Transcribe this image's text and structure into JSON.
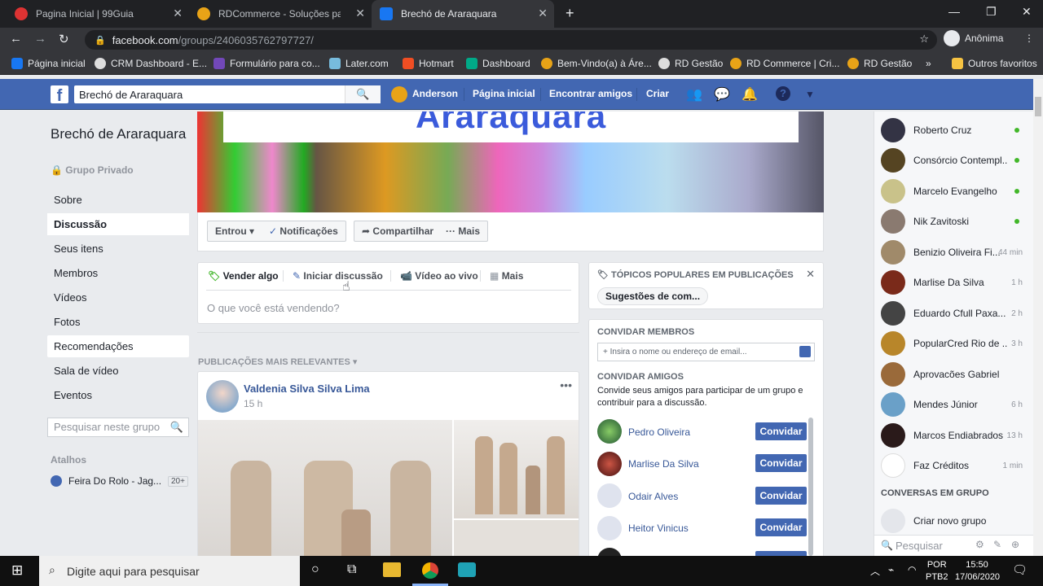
{
  "browser": {
    "tabs": [
      {
        "title": "Pagina Inicial | 99Guia",
        "active": false
      },
      {
        "title": "RDCommerce - Soluções para PME",
        "active": false
      },
      {
        "title": "Brechó de Araraquara",
        "active": true
      }
    ],
    "new_tab": "+",
    "url_domain": "facebook.com",
    "url_path": "/groups/2406035762797727/",
    "profile": "Anônima",
    "bookmarks": [
      "Página inicial",
      "CRM Dashboard - E...",
      "Formulário para co...",
      "Later.com",
      "Hotmart",
      "Dashboard",
      "Bem-Vindo(a) à Áre...",
      "RD Gestão",
      "RD Commerce | Cri...",
      "RD Gestão"
    ],
    "bookmarks_more": "»",
    "other_favorites": "Outros favoritos"
  },
  "fb": {
    "search_value": "Brechó de Araraquara",
    "user": "Anderson",
    "nav": [
      "Página inicial",
      "Encontrar amigos",
      "Criar"
    ]
  },
  "group": {
    "name": "Brechó de Araraquara",
    "privacy": "Grupo Privado",
    "cover_title": "Araraquara",
    "left_nav": [
      "Sobre",
      "Discussão",
      "Seus itens",
      "Membros",
      "Vídeos",
      "Fotos",
      "Recomendações",
      "Sala de vídeo",
      "Eventos"
    ],
    "search_placeholder": "Pesquisar neste grupo",
    "shortcuts_title": "Atalhos",
    "shortcut": "Feira Do Rolo - Jag...",
    "shortcut_count": "20+",
    "actions": {
      "joined": "Entrou",
      "notifications": "Notificações",
      "share": "Compartilhar",
      "more": "Mais"
    }
  },
  "composer": {
    "tabs": [
      "Vender algo",
      "Iniciar discussão",
      "Vídeo ao vivo",
      "Mais"
    ],
    "placeholder": "O que você está vendendo?"
  },
  "feed": {
    "sort_label": "PUBLICAÇÕES MAIS RELEVANTES",
    "post_author": "Valdenia Silva Silva Lima",
    "post_time": "15 h",
    "post_menu": "•••"
  },
  "topics": {
    "title": "TÓPICOS POPULARES EM PUBLICAÇÕES",
    "chip": "Sugestões de com..."
  },
  "invite": {
    "members_title": "CONVIDAR MEMBROS",
    "members_placeholder": "+ Insira o nome ou endereço de email...",
    "friends_title": "CONVIDAR AMIGOS",
    "friends_desc": "Convide seus amigos para participar de um grupo e contribuir para a discussão.",
    "button_label": "Convidar",
    "friends": [
      "Pedro Oliveira",
      "Marlise Da Silva",
      "Odair Alves",
      "Heitor Vinicus"
    ]
  },
  "chat": {
    "contacts": [
      {
        "name": "Roberto Cruz",
        "status": "online"
      },
      {
        "name": "Consórcio Contempl...",
        "status": "online"
      },
      {
        "name": "Marcelo Evangelho",
        "status": "online"
      },
      {
        "name": "Nik Zavitoski",
        "status": "online"
      },
      {
        "name": "Benizio Oliveira Fi...",
        "status": "44 min"
      },
      {
        "name": "Marlise Da Silva",
        "status": "1 h"
      },
      {
        "name": "Eduardo Cfull Paxa...",
        "status": "2 h"
      },
      {
        "name": "PopularCred Rio de ...",
        "status": "3 h"
      },
      {
        "name": "Aprovacões Gabriel",
        "status": ""
      },
      {
        "name": "Mendes Júnior",
        "status": "6 h"
      },
      {
        "name": "Marcos Endiabrados",
        "status": "13 h"
      },
      {
        "name": "Faz Créditos",
        "status": "1 min"
      }
    ],
    "group_conv_title": "CONVERSAS EM GRUPO",
    "new_group": "Criar novo grupo",
    "search_placeholder": "Pesquisar"
  },
  "taskbar": {
    "search": "Digite aqui para pesquisar",
    "lang1": "POR",
    "lang2": "PTB2",
    "time": "15:50",
    "date": "17/06/2020"
  },
  "colors": {
    "fb_blue": "#4267b2",
    "link": "#385898",
    "online": "#42b72a"
  }
}
